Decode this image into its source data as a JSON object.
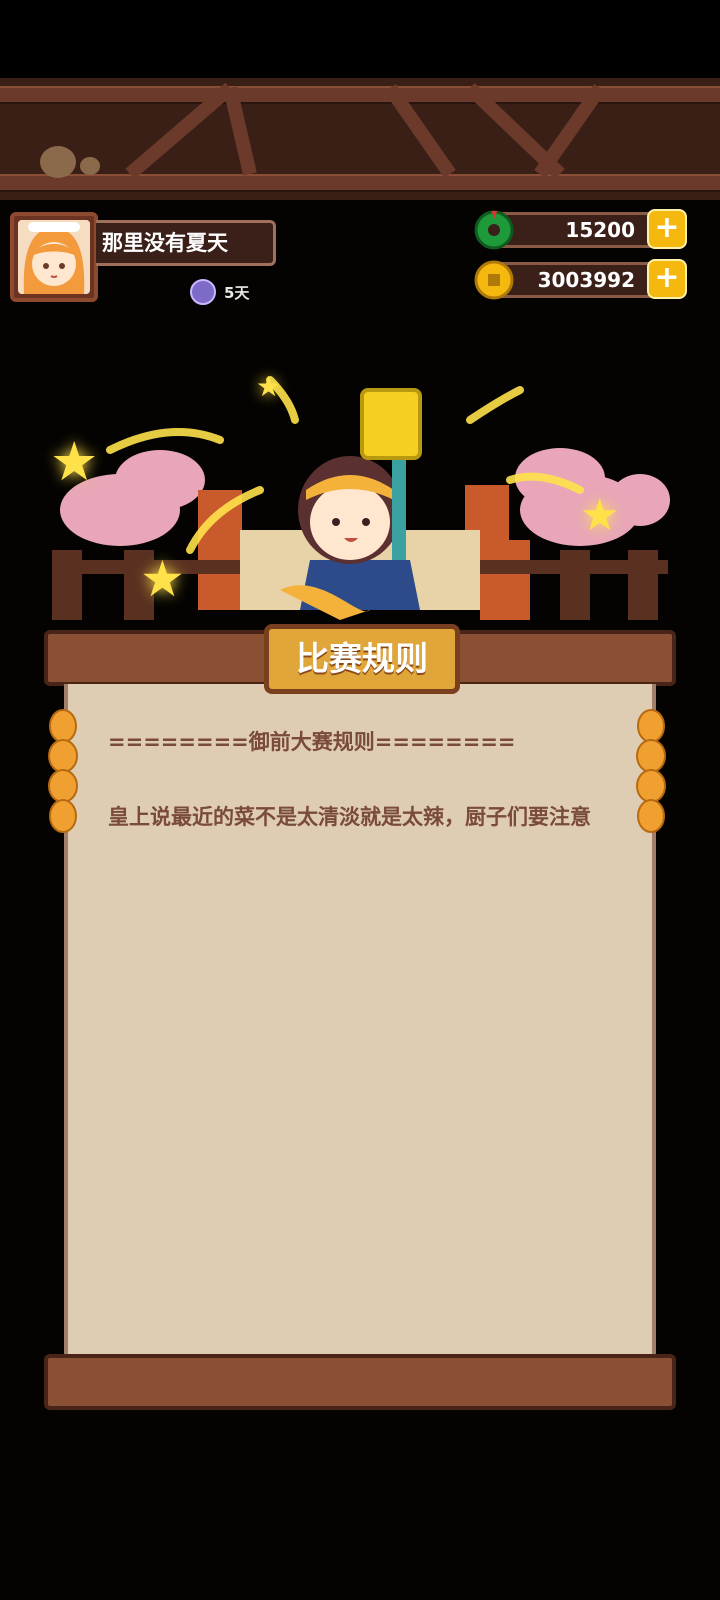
{
  "player": {
    "name": "那里没有夏天",
    "days": "5天"
  },
  "currency": {
    "jade": "15200",
    "coins": "3003992",
    "add_symbol": "+"
  },
  "panel": {
    "title": "比赛规则",
    "rule_heading": "========御前大赛规则========",
    "rule_body": "皇上说最近的菜不是太清淡就是太辣，厨子们要注意"
  },
  "colors": {
    "rule_text": "#7a4b39",
    "paper": "#dfcdb3",
    "plaque": "#e1a63a",
    "plus_button": "#f5b80e"
  },
  "icons": [
    "jade-icon",
    "coin-icon",
    "plus-icon",
    "day-badge-icon",
    "star-icon",
    "corn-icon"
  ]
}
